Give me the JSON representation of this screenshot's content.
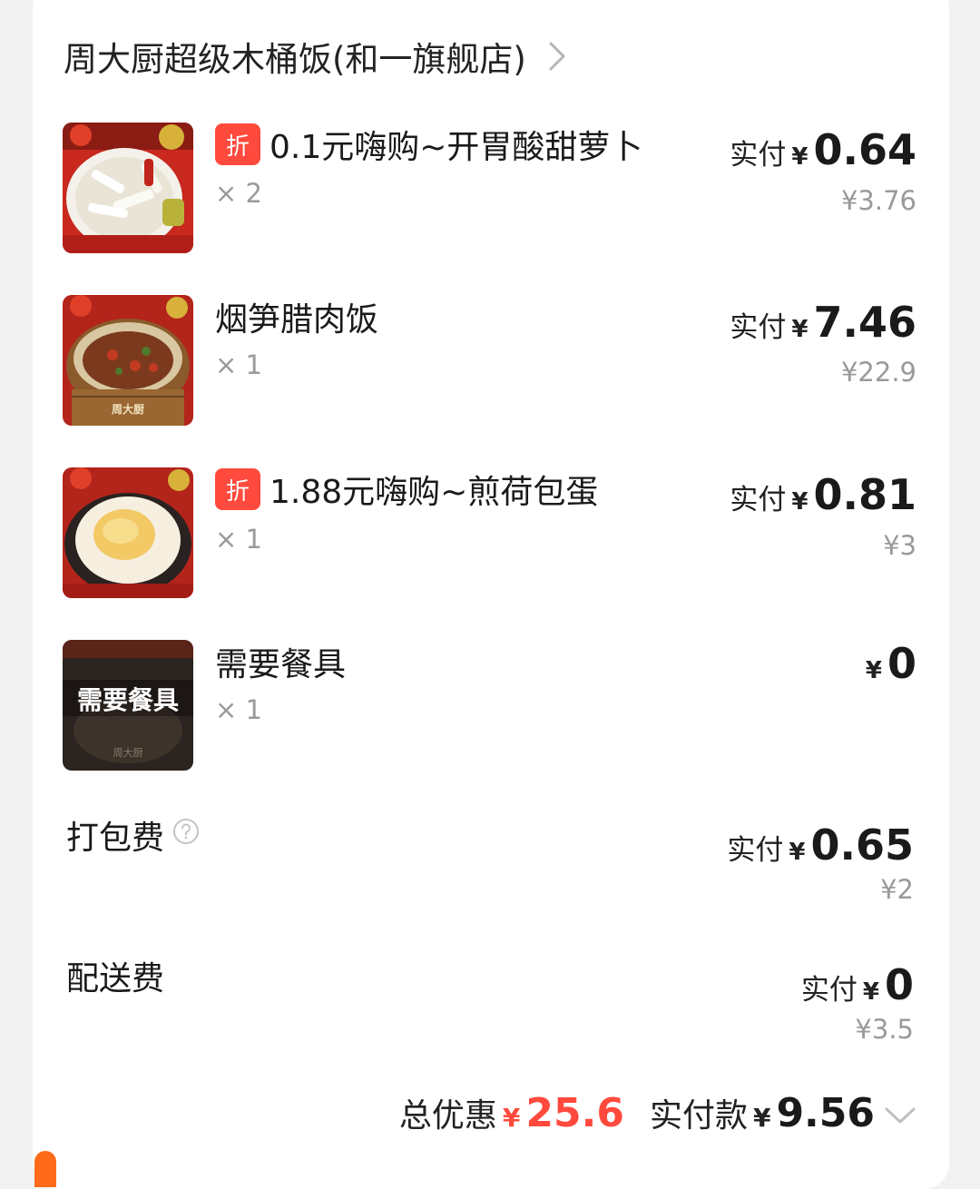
{
  "store": {
    "name": "周大厨超级木桶饭(和一旗舰店)"
  },
  "items": [
    {
      "title": "0.1元嗨购~开胃酸甜萝卜",
      "badge": "折",
      "qty": "× 2",
      "paid_label": "实付",
      "currency": "¥",
      "paid": "0.64",
      "original": "¥3.76",
      "thumb_icon": "pickled-radish-image"
    },
    {
      "title": "烟笋腊肉饭",
      "badge": "",
      "qty": "× 1",
      "paid_label": "实付",
      "currency": "¥",
      "paid": "7.46",
      "original": "¥22.9",
      "thumb_icon": "bamboo-bacon-rice-image",
      "thumb_text": "周大厨"
    },
    {
      "title": "1.88元嗨购~煎荷包蛋",
      "badge": "折",
      "qty": "× 1",
      "paid_label": "实付",
      "currency": "¥",
      "paid": "0.81",
      "original": "¥3",
      "thumb_icon": "fried-egg-image"
    },
    {
      "title": "需要餐具",
      "badge": "",
      "qty": "× 1",
      "paid_label": "",
      "currency": "¥",
      "paid": "0",
      "original": "",
      "thumb_icon": "tableware-image",
      "thumb_text": "需要餐具",
      "thumb_sub": "周大厨"
    }
  ],
  "fees": [
    {
      "label": "打包费",
      "paid_label": "实付",
      "currency": "¥",
      "paid": "0.65",
      "original": "¥2",
      "icon": "help-icon"
    },
    {
      "label": "配送费",
      "paid_label": "实付",
      "currency": "¥",
      "paid": "0",
      "original": "¥3.5"
    }
  ],
  "summary": {
    "discount_label": "总优惠",
    "discount_currency": "¥",
    "discount": "25.6",
    "total_label": "实付款",
    "total_currency": "¥",
    "total": "9.56"
  },
  "colors": {
    "accent_red": "#ff4a3d",
    "muted_gray": "#9a9a9a",
    "orange": "#ff6a1a"
  }
}
